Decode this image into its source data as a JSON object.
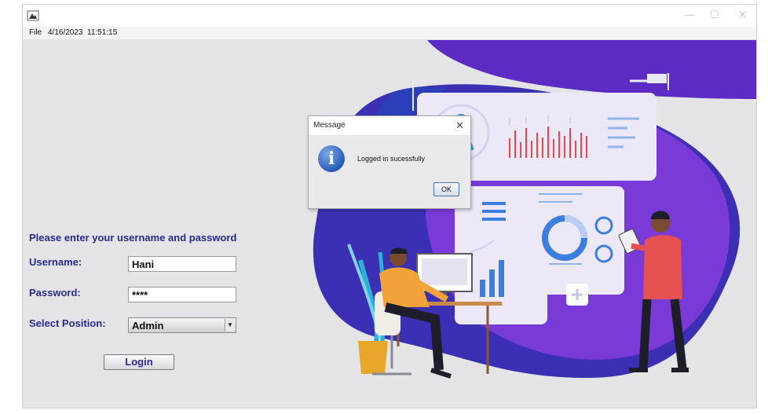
{
  "menubar": {
    "file_label": "File",
    "date": "4/16/2023",
    "time": "11:51:15"
  },
  "form": {
    "heading": "Please enter your username and password",
    "username_label": "Username:",
    "username_value": "Hani",
    "password_label": "Password:",
    "password_value": "****",
    "position_label": "Select Position:",
    "position_value": "Admin",
    "login_label": "Login"
  },
  "dialog": {
    "title": "Message",
    "close": "✕",
    "message": "Logged in sucessfully",
    "ok_label": "OK",
    "icon": "info-icon"
  },
  "window": {
    "minimize": "—",
    "maximize": "☐",
    "close": "✕"
  },
  "colors": {
    "label": "#2a2a8c",
    "illustration_purple": "#6a2fd0",
    "illustration_blue": "#3b2fb3"
  }
}
